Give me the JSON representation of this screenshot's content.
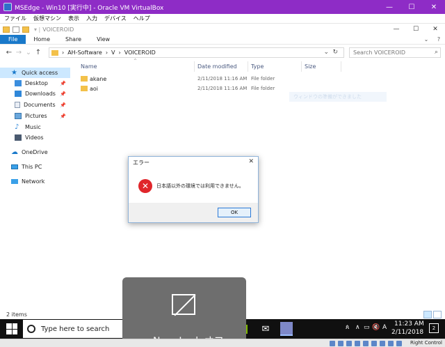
{
  "vbox": {
    "title": "MSEdge - Win10 [実行中] - Oracle VM VirtualBox",
    "menu": [
      "ファイル",
      "仮想マシン",
      "表示",
      "入力",
      "デバイス",
      "ヘルプ"
    ],
    "host_key": "Right Control",
    "min": "—",
    "max": "☐",
    "close": "✕"
  },
  "explorer": {
    "title": "VOICEROID",
    "min": "—",
    "max": "☐",
    "close": "✕",
    "ribbon_tabs": [
      "File",
      "Home",
      "Share",
      "View"
    ],
    "nav": {
      "back": "←",
      "forward": "→",
      "recent": "⌄",
      "up": "↑"
    },
    "address": [
      "›",
      "AH-Software",
      "›",
      "V",
      "›",
      "VOICEROID"
    ],
    "address_dropdown": "⌄",
    "refresh": "↻",
    "search_placeholder": "Search VOICEROID",
    "search_icon": "⌕",
    "sidebar": [
      {
        "label": "Quick access",
        "icon": "star-icon",
        "pinned": false
      },
      {
        "label": "Desktop",
        "icon": "desktop-icon",
        "pinned": true
      },
      {
        "label": "Downloads",
        "icon": "downloads-icon",
        "pinned": true
      },
      {
        "label": "Documents",
        "icon": "documents-icon",
        "pinned": true
      },
      {
        "label": "Pictures",
        "icon": "pictures-icon",
        "pinned": true
      },
      {
        "label": "Music",
        "icon": "music-icon",
        "pinned": false
      },
      {
        "label": "Videos",
        "icon": "videos-icon",
        "pinned": false
      },
      {
        "label": "OneDrive",
        "icon": "onedrive-icon",
        "pinned": false
      },
      {
        "label": "This PC",
        "icon": "this-pc-icon",
        "pinned": false
      },
      {
        "label": "Network",
        "icon": "network-icon",
        "pinned": false
      }
    ],
    "columns": [
      "Name",
      "Date modified",
      "Type",
      "Size"
    ],
    "files": [
      {
        "name": "akane",
        "date": "2/11/2018 11:16 AM",
        "type": "File folder"
      },
      {
        "name": "aoi",
        "date": "2/11/2018 11:16 AM",
        "type": "File folder"
      }
    ],
    "ghost_window_text": "ウィンドウの準備ができました",
    "item_count": "2 items"
  },
  "dialog": {
    "title": "エラー",
    "close": "✕",
    "error_glyph": "✕",
    "message": "日本語以外の環境では利用できません。",
    "ok": "OK"
  },
  "taskbar": {
    "search_placeholder": "Type here to search",
    "mic": "🎤",
    "mail": "✉",
    "tray": {
      "people": "ጰ",
      "chevron": "∧",
      "network": "▭",
      "volume": "🔇",
      "ime": "A"
    },
    "time": "11:23 AM",
    "date": "2/11/2018",
    "notification_count": "2"
  },
  "numlock": {
    "label": "Num Lock オフ"
  },
  "colors": {
    "vbox_title": "#8e2cc6",
    "file_tab": "#1979ca",
    "selection": "#cce8ff",
    "error": "#e0262b",
    "taskbar": "#101010",
    "folder": "#f3c14a"
  }
}
